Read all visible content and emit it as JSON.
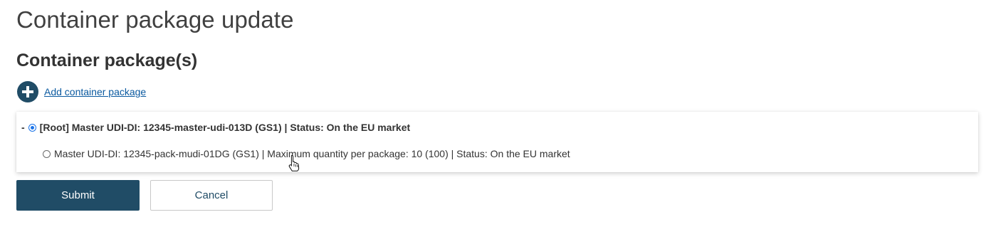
{
  "page": {
    "title": "Container package update"
  },
  "section": {
    "title": "Container package(s)",
    "add_link_label": "Add container package",
    "add_icon": "plus-circle-icon"
  },
  "tree": {
    "root": {
      "prefix": "-",
      "selected": true,
      "label": "[Root] Master UDI-DI: 12345-master-udi-013D (GS1) | Status: On the EU market"
    },
    "children": [
      {
        "selected": false,
        "label": "Master UDI-DI: 12345-pack-mudi-01DG (GS1) | Maximum quantity per package: 10 (100) | Status: On the EU market"
      }
    ]
  },
  "actions": {
    "submit_label": "Submit",
    "cancel_label": "Cancel"
  },
  "colors": {
    "primary": "#204c66",
    "link": "#0b5aa0",
    "radio_selected": "#1a73e8"
  }
}
